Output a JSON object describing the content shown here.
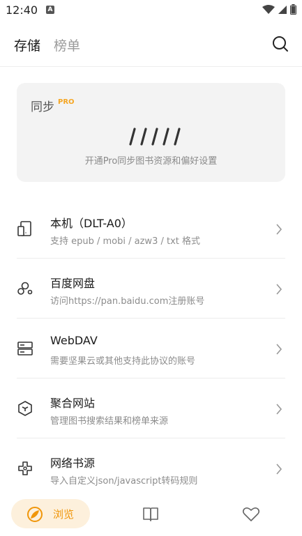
{
  "status_bar": {
    "time": "12:40",
    "notification_letter": "A"
  },
  "header": {
    "tabs": [
      {
        "label": "存储",
        "active": true
      },
      {
        "label": "榜单",
        "active": false
      }
    ],
    "search_icon": "search-icon"
  },
  "sync_card": {
    "title": "同步",
    "badge": "PRO",
    "description": "开通Pro同步图书资源和偏好设置"
  },
  "sources": [
    {
      "title": "本机（DLT-A0）",
      "subtitle": "支持 epub / mobi / azw3 / txt 格式",
      "icon": "phone-icon"
    },
    {
      "title": "百度网盘",
      "subtitle": "访问https://pan.baidu.com注册账号",
      "icon": "cloud-nodes-icon"
    },
    {
      "title": "WebDAV",
      "subtitle": "需要坚果云或其他支持此协议的账号",
      "icon": "server-icon"
    },
    {
      "title": "聚合网站",
      "subtitle": "管理图书搜索结果和榜单来源",
      "icon": "hexagon-icon"
    },
    {
      "title": "网络书源",
      "subtitle": "导入自定义json/javascript转码规则",
      "icon": "plugin-icon"
    }
  ],
  "bottom_nav": {
    "browse_label": "浏览",
    "accent_color": "#f0960a"
  }
}
